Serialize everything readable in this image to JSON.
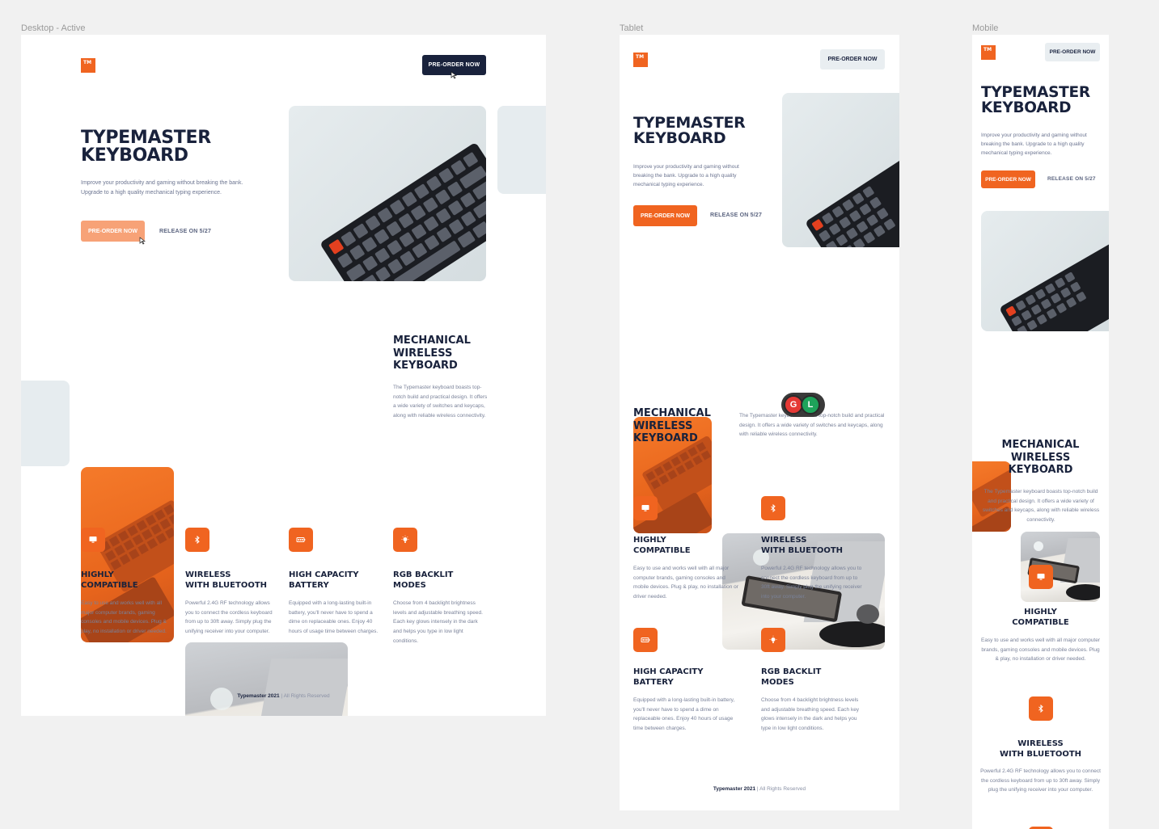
{
  "frames": {
    "desktop": "Desktop - Active",
    "tablet": "Tablet",
    "mobile": "Mobile"
  },
  "brand": {
    "logo": "TM",
    "accent": "#f06420",
    "dark": "#19223c"
  },
  "header": {
    "cta": "PRE-ORDER NOW"
  },
  "hero": {
    "title_line1": "TYPEMASTER",
    "title_line2": "KEYBOARD",
    "description": "Improve your productivity and gaming without breaking the bank. Upgrade to a high quality mechanical typing experience.",
    "cta": "PRE-ORDER NOW",
    "release": "RELEASE ON 5/27"
  },
  "about": {
    "title_line1": "MECHANICAL",
    "title_line2": "WIRELESS",
    "title_line3": "KEYBOARD",
    "description": "The Typemaster keyboard boasts top-notch build and practical design. It offers a wide variety of switches and keycaps, along with reliable wireless connectivity."
  },
  "features": [
    {
      "icon": "monitor-icon",
      "title_line1": "HIGHLY",
      "title_line2": "COMPATIBLE",
      "description": "Easy to use and works well with all major computer brands, gaming consoles and mobile devices. Plug & play, no installation or driver needed."
    },
    {
      "icon": "bluetooth-icon",
      "title_line1": "WIRELESS",
      "title_line2": "WITH BLUETOOTH",
      "description": "Powerful 2.4G RF technology allows you to connect the cordless keyboard from up to 30ft away. Simply plug the unifying receiver into your computer."
    },
    {
      "icon": "battery-icon",
      "title_line1": "HIGH CAPACITY",
      "title_line2": "BATTERY",
      "description": "Equipped with a long-lasting built-in battery, you'll never have to spend a dime on replaceable ones. Enjoy 40 hours of usage time between charges."
    },
    {
      "icon": "lightbulb-icon",
      "title_line1": "RGB BACKLIT",
      "title_line2": "MODES",
      "description": "Choose from 4 backlight brightness levels and adjustable breathing speed. Each key glows intensely in the dark and helps you type in low light conditions."
    }
  ],
  "footer": {
    "brand": "Typemaster 2021",
    "sep": " | ",
    "rights": "All Rights Reserved"
  },
  "collaborators": [
    {
      "initial": "G",
      "color": "#e53935"
    },
    {
      "initial": "L",
      "color": "#1ea35a"
    }
  ]
}
